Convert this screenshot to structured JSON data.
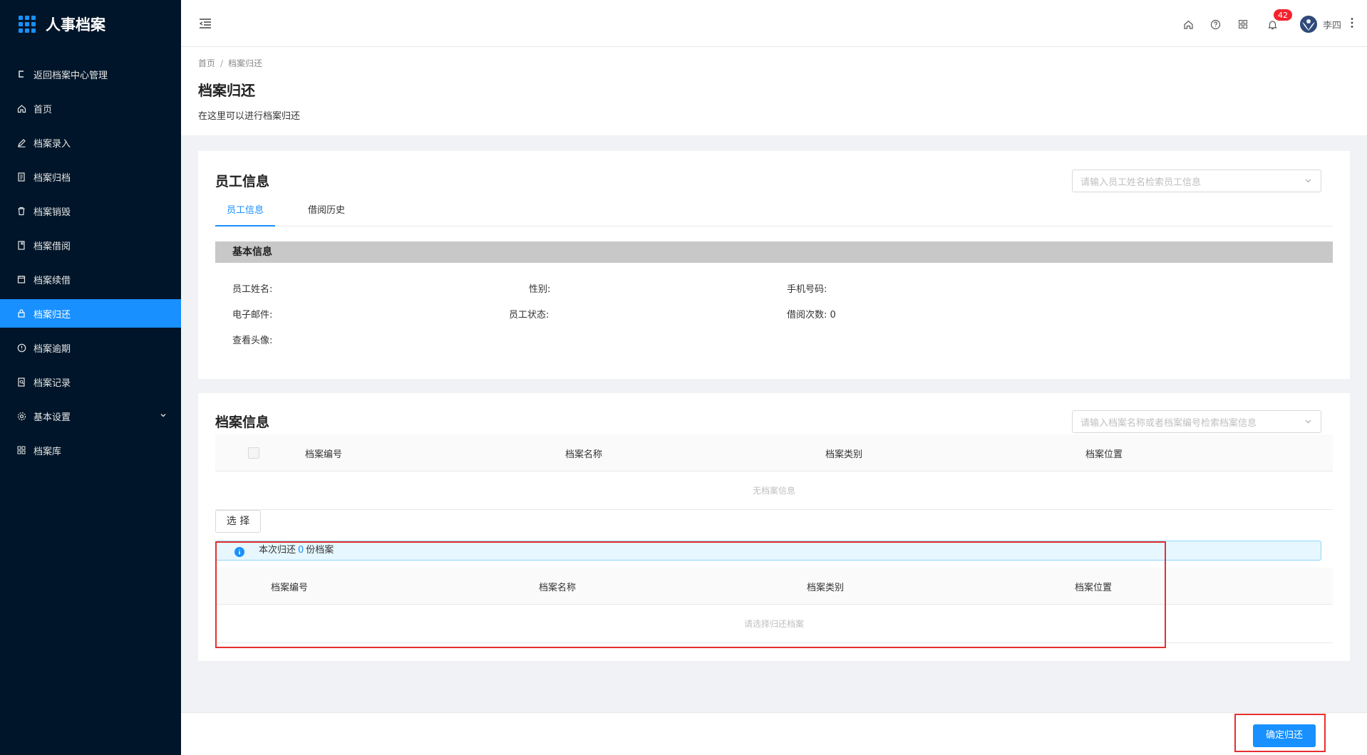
{
  "app": {
    "title": "人事档案"
  },
  "sidebar": {
    "items": [
      {
        "label": "返回档案中心管理",
        "icon": "back-icon"
      },
      {
        "label": "首页",
        "icon": "home-icon"
      },
      {
        "label": "档案录入",
        "icon": "edit-icon"
      },
      {
        "label": "档案归档",
        "icon": "file-icon"
      },
      {
        "label": "档案销毁",
        "icon": "trash-icon"
      },
      {
        "label": "档案借阅",
        "icon": "book-icon"
      },
      {
        "label": "档案续借",
        "icon": "calendar-icon"
      },
      {
        "label": "档案归还",
        "icon": "lock-icon",
        "active": true
      },
      {
        "label": "档案逾期",
        "icon": "alert-icon"
      },
      {
        "label": "档案记录",
        "icon": "record-icon"
      },
      {
        "label": "基本设置",
        "icon": "gear-icon",
        "has_children": true
      },
      {
        "label": "档案库",
        "icon": "grid-icon"
      }
    ]
  },
  "header": {
    "notification_count": "42",
    "user_name": "李四"
  },
  "page": {
    "breadcrumb": [
      "首页",
      "档案归还"
    ],
    "title": "档案归还",
    "description": "在这里可以进行档案归还"
  },
  "employee_card": {
    "title": "员工信息",
    "search_placeholder": "请输入员工姓名检索员工信息",
    "tabs": [
      "员工信息",
      "借阅历史"
    ],
    "section_title": "基本信息",
    "fields": {
      "name_label": "员工姓名:",
      "gender_label": "性别:",
      "phone_label": "手机号码:",
      "email_label": "电子邮件:",
      "status_label": "员工状态:",
      "borrow_count_label": "借阅次数:",
      "borrow_count_value": "0",
      "avatar_label": "查看头像:"
    }
  },
  "archive_card": {
    "title": "档案信息",
    "search_placeholder": "请输入档案名称或者档案编号检索档案信息",
    "columns": [
      "档案编号",
      "档案名称",
      "档案类别",
      "档案位置"
    ],
    "empty_text": "无档案信息",
    "select_button": "选 择",
    "alert_prefix": "本次归还",
    "alert_count": "0",
    "alert_suffix": "份档案",
    "return_columns": [
      "档案编号",
      "档案名称",
      "档案类别",
      "档案位置"
    ],
    "return_empty_text": "请选择归还档案"
  },
  "footer": {
    "confirm_button": "确定归还"
  },
  "colors": {
    "primary": "#1890ff",
    "sidebar_bg": "#001529",
    "highlight_frame": "#e62e2e"
  }
}
